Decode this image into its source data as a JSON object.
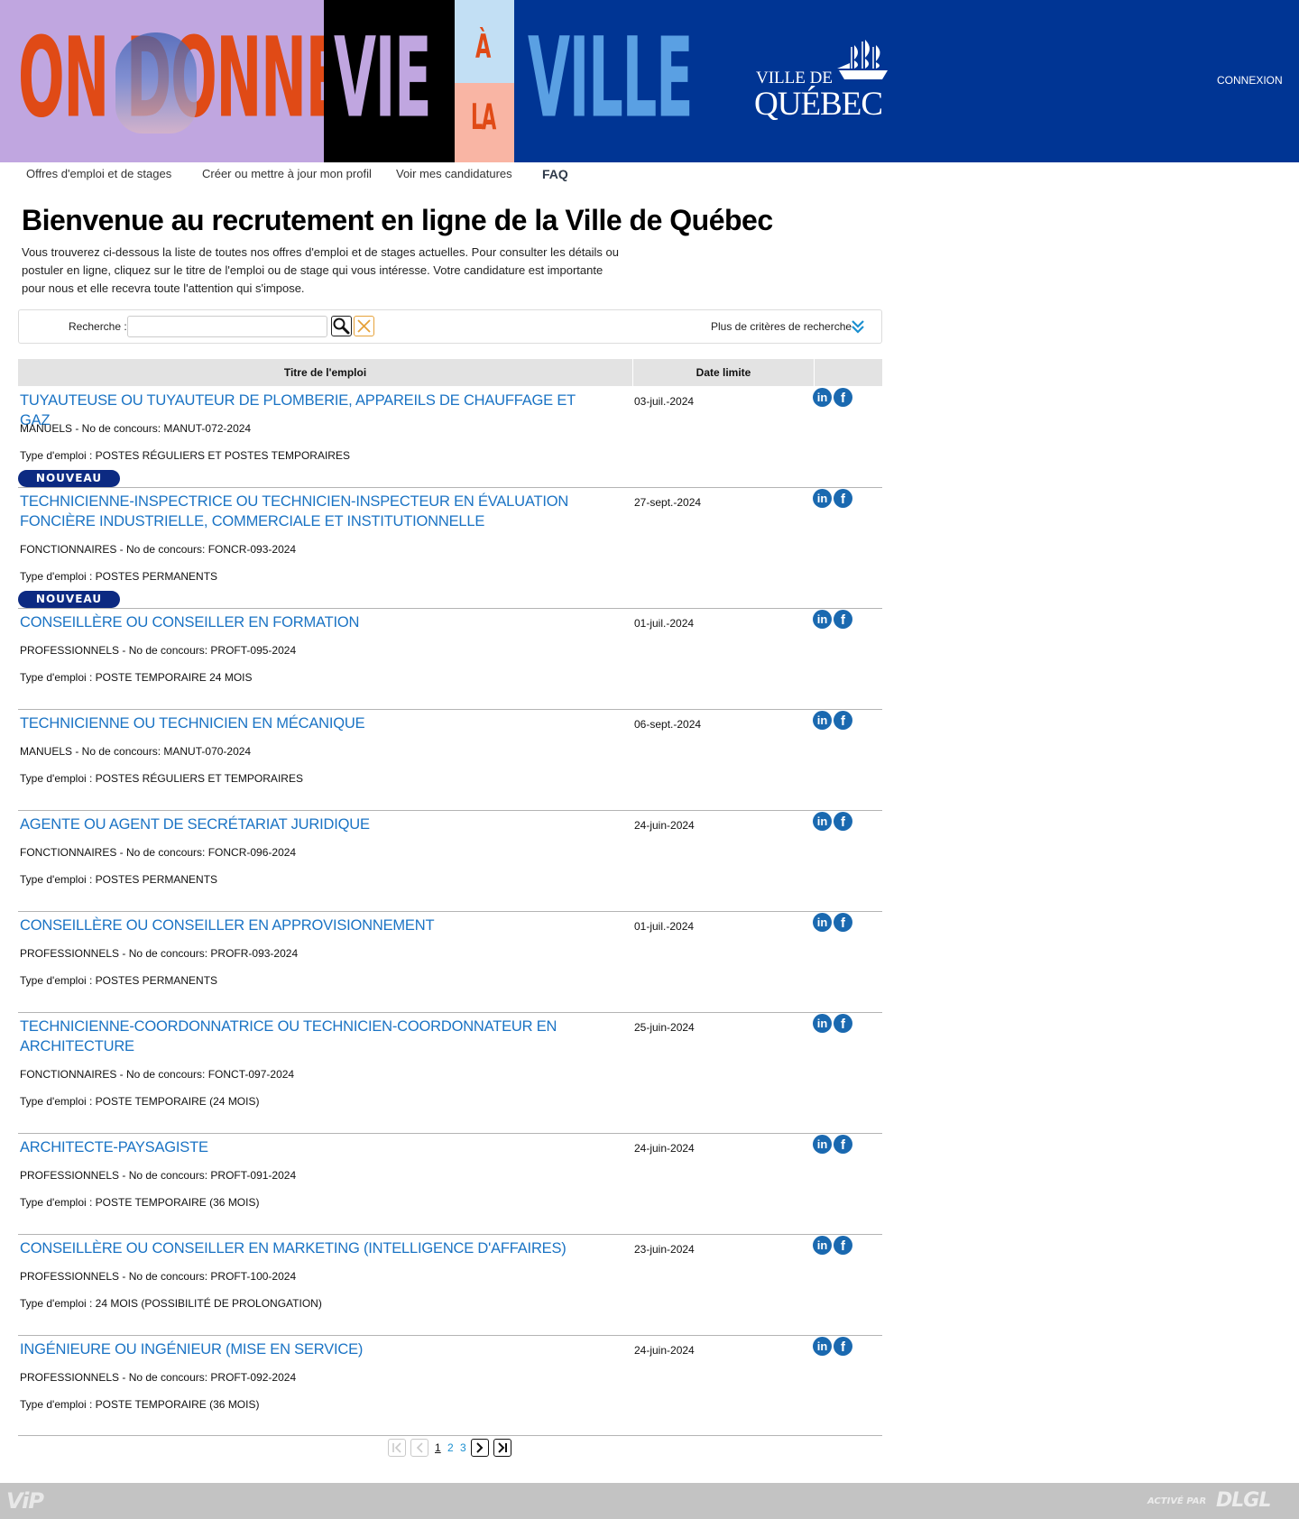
{
  "banner": {
    "words": [
      "ON DONNE",
      "VIE",
      "À",
      "LA",
      "VILLE"
    ],
    "logo_top": "VILLE DE",
    "logo_main": "QUÉBEC",
    "connexion": "CONNEXION",
    "colors": {
      "navy": "#003594",
      "orange": "#e04a16",
      "lilac": "#c0a6e0",
      "sky": "#5aa0e3",
      "salmon": "#f9b5a4"
    }
  },
  "nav": {
    "items": [
      "Offres d'emploi et de stages",
      "Créer ou mettre à jour mon profil",
      "Voir mes candidatures",
      "FAQ"
    ]
  },
  "intro": {
    "title": "Bienvenue au recrutement en ligne de la Ville de Québec",
    "text": "Vous trouverez ci-dessous la liste de toutes nos offres d'emploi et de stages actuelles. Pour consulter les détails ou postuler en ligne, cliquez sur le titre de l'emploi ou de stage qui vous intéresse. Votre candidature est importante pour nous et elle recevra toute l'attention qui s'impose."
  },
  "search": {
    "label": "Recherche :",
    "value": "",
    "more_criteria": "Plus de critères de recherche",
    "search_icon": "magnifier-icon",
    "clear_icon": "x-icon"
  },
  "table": {
    "headers": [
      "Titre de l'emploi",
      "Date limite"
    ],
    "new_badge": "NOUVEAU",
    "rows": [
      {
        "title": "TUYAUTEUSE OU TUYAUTEUR DE PLOMBERIE, APPAREILS DE CHAUFFAGE ET GAZ",
        "concours": "MANUELS - No de concours: MANUT-072-2024",
        "type": "Type d'emploi : POSTES RÉGULIERS ET POSTES TEMPORAIRES",
        "date": "03-juil.-2024",
        "new": true
      },
      {
        "title": "TECHNICIENNE-INSPECTRICE OU TECHNICIEN-INSPECTEUR EN ÉVALUATION FONCIÈRE INDUSTRIELLE, COMMERCIALE ET INSTITUTIONNELLE",
        "concours": "FONCTIONNAIRES - No de concours: FONCR-093-2024",
        "type": "Type d'emploi : POSTES PERMANENTS",
        "date": "27-sept.-2024",
        "new": true
      },
      {
        "title": "CONSEILLÈRE OU CONSEILLER EN FORMATION",
        "concours": "PROFESSIONNELS - No de concours: PROFT-095-2024",
        "type": "Type d'emploi : POSTE TEMPORAIRE 24 MOIS",
        "date": "01-juil.-2024",
        "new": false
      },
      {
        "title": "TECHNICIENNE OU TECHNICIEN EN MÉCANIQUE",
        "concours": "MANUELS - No de concours: MANUT-070-2024",
        "type": "Type d'emploi : POSTES RÉGULIERS ET TEMPORAIRES",
        "date": "06-sept.-2024",
        "new": false
      },
      {
        "title": "AGENTE OU AGENT DE SECRÉTARIAT JURIDIQUE",
        "concours": "FONCTIONNAIRES - No de concours: FONCR-096-2024",
        "type": "Type d'emploi : POSTES PERMANENTS",
        "date": "24-juin-2024",
        "new": false
      },
      {
        "title": "CONSEILLÈRE OU CONSEILLER EN APPROVISIONNEMENT",
        "concours": "PROFESSIONNELS - No de concours: PROFR-093-2024",
        "type": "Type d'emploi : POSTES PERMANENTS",
        "date": "01-juil.-2024",
        "new": false
      },
      {
        "title": "TECHNICIENNE-COORDONNATRICE OU TECHNICIEN-COORDONNATEUR EN ARCHITECTURE",
        "concours": "FONCTIONNAIRES - No de concours: FONCT-097-2024",
        "type": "Type d'emploi : POSTE TEMPORAIRE (24 MOIS)",
        "date": "25-juin-2024",
        "new": false
      },
      {
        "title": "ARCHITECTE-PAYSAGISTE",
        "concours": "PROFESSIONNELS - No de concours: PROFT-091-2024",
        "type": "Type d'emploi : POSTE TEMPORAIRE (36 MOIS)",
        "date": "24-juin-2024",
        "new": false
      },
      {
        "title": "CONSEILLÈRE OU CONSEILLER EN MARKETING (INTELLIGENCE D'AFFAIRES)",
        "concours": "PROFESSIONNELS - No de concours: PROFT-100-2024",
        "type": "Type d'emploi : 24 MOIS (POSSIBILITÉ DE PROLONGATION)",
        "date": "23-juin-2024",
        "new": false
      },
      {
        "title": "INGÉNIEURE OU INGÉNIEUR (MISE EN SERVICE)",
        "concours": "PROFESSIONNELS - No de concours: PROFT-092-2024",
        "type": "Type d'emploi : POSTE TEMPORAIRE (36 MOIS)",
        "date": "24-juin-2024",
        "new": false
      }
    ]
  },
  "pagination": {
    "pages": [
      "1",
      "2",
      "3"
    ],
    "current": "1"
  },
  "footer": {
    "left": "ViP",
    "active_par": "ACTIVÉ PAR",
    "brand": "DLGL"
  }
}
